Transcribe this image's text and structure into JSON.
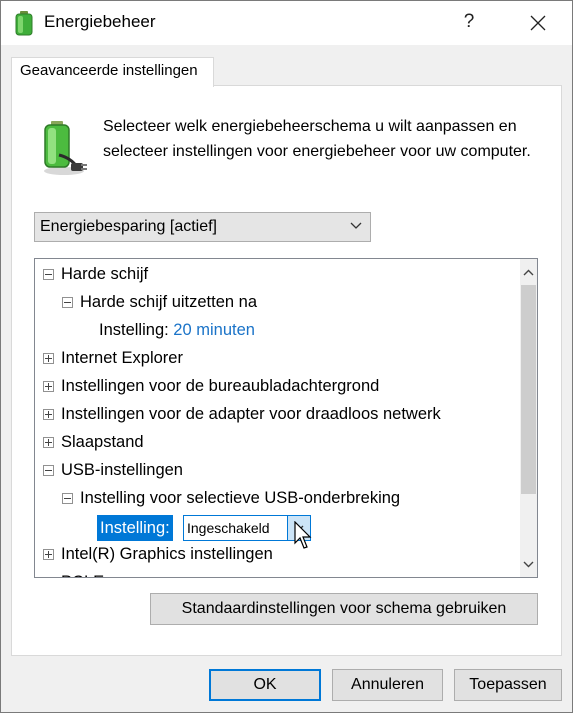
{
  "window": {
    "title": "Energiebeheer",
    "help_label": "?",
    "close_icon": "close-icon"
  },
  "tab": {
    "label": "Geavanceerde instellingen"
  },
  "description": "Selecteer welk energiebeheerschema u wilt aanpassen en selecteer instellingen voor energiebeheer voor uw computer.",
  "plan_select": {
    "value": "Energiebesparing [actief]"
  },
  "tree": {
    "items": [
      {
        "label": "Harde schijf",
        "expander": "minus"
      },
      {
        "label": "Harde schijf uitzetten na",
        "expander": "minus"
      },
      {
        "label": "Instelling:",
        "value": "20 minuten"
      },
      {
        "label": "Internet Explorer",
        "expander": "plus"
      },
      {
        "label": "Instellingen voor de bureaubladachtergrond",
        "expander": "plus"
      },
      {
        "label": "Instellingen voor de adapter voor draadloos netwerk",
        "expander": "plus"
      },
      {
        "label": "Slaapstand",
        "expander": "plus"
      },
      {
        "label": "USB-instellingen",
        "expander": "minus"
      },
      {
        "label": "Instelling voor selectieve USB-onderbreking",
        "expander": "minus"
      },
      {
        "label": "Instelling:",
        "value": "Ingeschakeld"
      },
      {
        "label": "Intel(R) Graphics instellingen",
        "expander": "plus"
      },
      {
        "label": "PCI Express",
        "expander": "plus"
      }
    ]
  },
  "buttons": {
    "restore_defaults": "Standaardinstellingen voor schema gebruiken",
    "ok": "OK",
    "cancel": "Annuleren",
    "apply": "Toepassen"
  },
  "colors": {
    "accent": "#0078d7",
    "link": "#1a73c8"
  }
}
